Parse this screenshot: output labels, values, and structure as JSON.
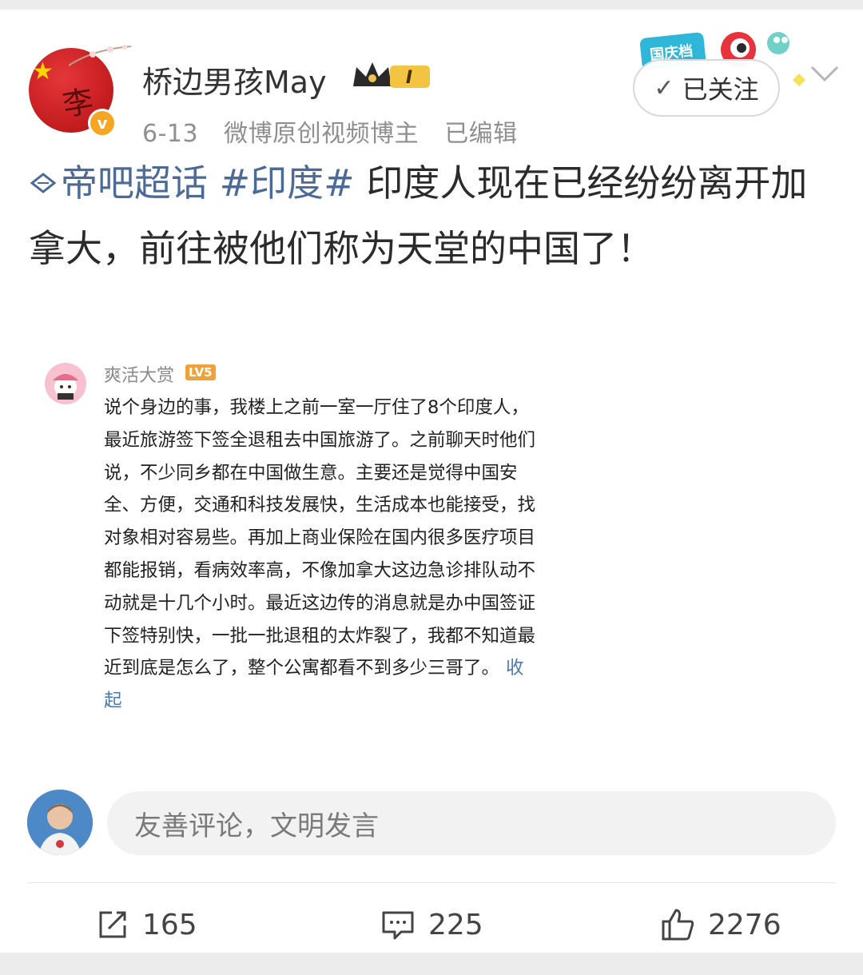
{
  "header": {
    "username": "桥边男孩May",
    "vip_level": "I",
    "date": "6-13",
    "role": "微博原创视频博主",
    "edited": "已编辑",
    "follow_label": "已关注",
    "deco_label": "国庆档",
    "avatar_seal": "李"
  },
  "post": {
    "supertopic": "帝吧超话",
    "hashtag": "#印度#",
    "text": "印度人现在已经纷纷离开加拿大，前往被他们称为天堂的中国了！"
  },
  "embedded": {
    "name": "爽活大赏",
    "level": "LV5",
    "body": "说个身边的事，我楼上之前一室一厅住了8个印度人，最近旅游签下签全退租去中国旅游了。之前聊天时他们说，不少同乡都在中国做生意。主要还是觉得中国安全、方便，交通和科技发展快，生活成本也能接受，找对象相对容易些。再加上商业保险在国内很多医疗项目都能报销，看病效率高，不像加拿大这边急诊排队动不动就是十几个小时。最近这边传的消息就是办中国签证下签特别快，一批一批退租的太炸裂了，我都不知道最近到底是怎么了，整个公寓都看不到多少三哥了。",
    "collapse_label": "收起"
  },
  "comment": {
    "placeholder": "友善评论，文明发言"
  },
  "actions": {
    "reposts": "165",
    "comments": "225",
    "likes": "2276"
  },
  "colors": {
    "topic_blue": "#4b6a98",
    "link_blue": "#4a79b5",
    "badge_orange": "#f5a623"
  }
}
